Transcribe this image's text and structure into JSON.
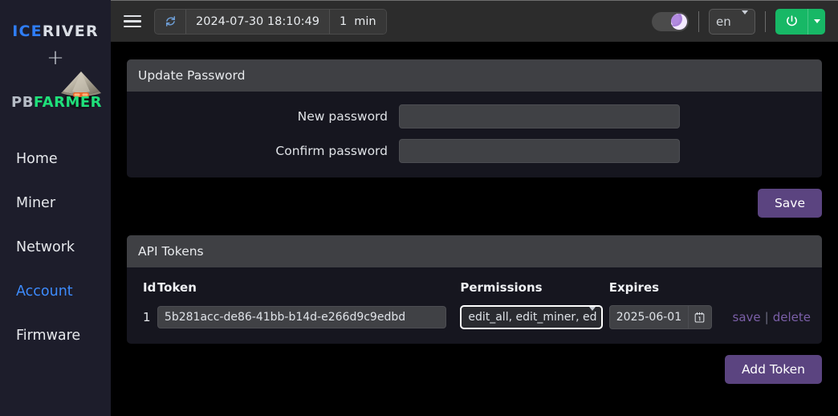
{
  "sidebar": {
    "brand": {
      "ice": "ICE",
      "river": "RIVER",
      "plus": "+",
      "pb": "PB",
      "farmer": "FARMER"
    },
    "items": [
      {
        "label": "Home",
        "active": false
      },
      {
        "label": "Miner",
        "active": false
      },
      {
        "label": "Network",
        "active": false
      },
      {
        "label": "Account",
        "active": true
      },
      {
        "label": "Firmware",
        "active": false
      }
    ]
  },
  "topbar": {
    "menu_icon": "hamburger-icon",
    "refresh_icon": "refresh-icon",
    "timestamp": "2024-07-30 18:10:49",
    "interval_value": "1",
    "interval_unit": "min",
    "theme_toggle_icon": "moon-icon",
    "language": "en",
    "language_options": [
      "en"
    ],
    "power_icon": "power-icon"
  },
  "password_card": {
    "title": "Update Password",
    "fields": [
      {
        "label": "New password",
        "value": "",
        "placeholder": ""
      },
      {
        "label": "Confirm password",
        "value": "",
        "placeholder": ""
      }
    ],
    "save_label": "Save"
  },
  "tokens_card": {
    "title": "API Tokens",
    "columns": [
      "Id",
      "Token",
      "Permissions",
      "Expires"
    ],
    "rows": [
      {
        "id": "1",
        "token": "5b281acc-de86-41bb-b14d-e266d9c9edbd",
        "permissions": "edit_all, edit_miner, ed",
        "expires": "2025-06-01",
        "calendar_icon": "calendar-icon",
        "save_label": "save",
        "separator": "|",
        "delete_label": "delete"
      }
    ],
    "add_label": "Add Token"
  },
  "colors": {
    "accent_purple": "#5b4480",
    "accent_green": "#17b866",
    "accent_blue": "#3d8bfd",
    "brand_green": "#1fe07a",
    "brand_blue": "#2f7df6",
    "sidebar_bg": "#1d1d2b",
    "card_bg": "#16161f",
    "card_header_bg": "#3f4044",
    "topbar_bg": "#2c2c2c"
  }
}
